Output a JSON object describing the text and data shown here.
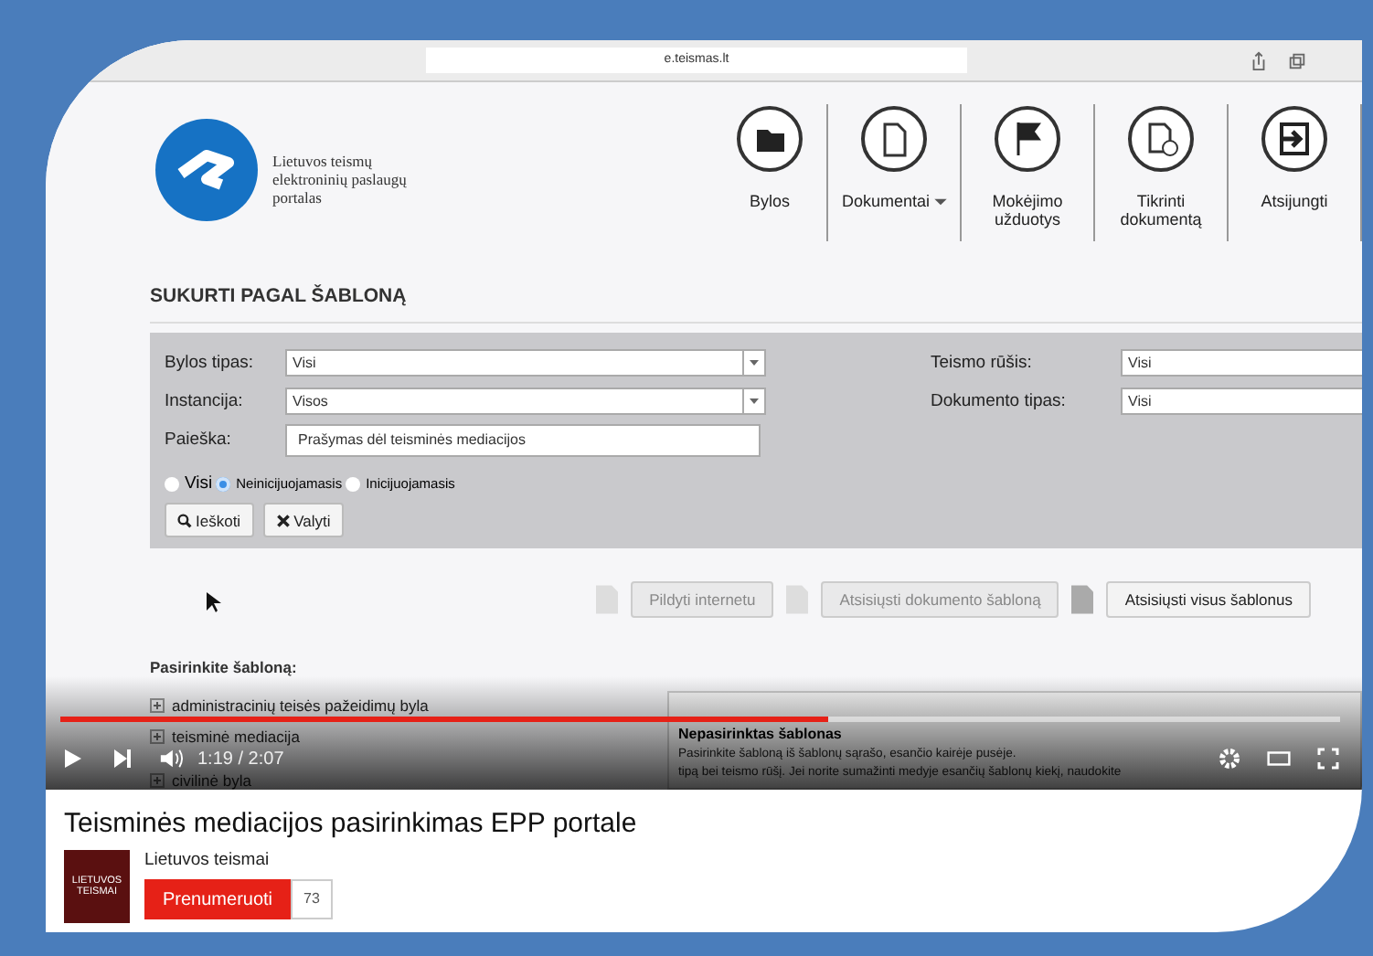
{
  "browser": {
    "url": "e.teismas.lt"
  },
  "site": {
    "logo_text": [
      "Lietuvos teismų",
      "elektroninių paslaugų",
      "portalas"
    ],
    "nav": [
      {
        "label": "Bylos",
        "kind": "folder",
        "caret": false
      },
      {
        "label": "Dokumentai",
        "kind": "document",
        "caret": true
      },
      {
        "label": "Mokėjimo užduotys",
        "kind": "flag",
        "caret": false
      },
      {
        "label": "Tikrinti dokumentą",
        "kind": "check",
        "caret": false
      },
      {
        "label": "Atsijungti",
        "kind": "logout",
        "caret": false
      }
    ]
  },
  "form": {
    "title": "SUKURTI PAGAL ŠABLONĄ",
    "left_fields": [
      {
        "label": "Bylos tipas:",
        "value": "Visi",
        "kind": "select"
      },
      {
        "label": "Instancija:",
        "value": "Visos",
        "kind": "select"
      },
      {
        "label": "Paieška:",
        "value": "Prašymas dėl teisminės mediacijos",
        "kind": "text"
      }
    ],
    "right_fields": [
      {
        "label": "Teismo rūšis:",
        "value": "Visi"
      },
      {
        "label": "Dokumento tipas:",
        "value": "Visi"
      }
    ],
    "radios": [
      {
        "label": "Visi",
        "selected": false
      },
      {
        "label": "Neinicijuojamasis",
        "selected": true
      },
      {
        "label": "Inicijuojamasis",
        "selected": false
      }
    ],
    "buttons": [
      {
        "label": "Ieškoti",
        "kind": "search"
      },
      {
        "label": "Valyti",
        "kind": "clear"
      }
    ]
  },
  "actions": [
    {
      "label": "Pildyti internetu",
      "disabled": true
    },
    {
      "label": "Atsisiųsti dokumento šabloną",
      "disabled": true
    },
    {
      "label": "Atsisiųsti visus šablonus",
      "disabled": false
    }
  ],
  "templates": {
    "heading": "Pasirinkite šabloną:",
    "tree": [
      {
        "label": "administracinių teisės pažeidimų byla"
      },
      {
        "label": "teisminė mediacija"
      },
      {
        "label": "civilinė byla"
      }
    ],
    "panel_title": "Nepasirinktas šablonas",
    "panel_text": [
      "Pasirinkite šabloną iš šablonų sąrašo, esančio kairėje pusėje.",
      "tipą bei teismo rūšį. Jei norite sumažinti medyje esančių šablonų kiekį, naudokite"
    ]
  },
  "player": {
    "level": 0.6,
    "time": "1:19 / 2:07"
  },
  "video": {
    "title": "Teisminės mediacijos pasirinkimas EPP portale",
    "channel": "Lietuvos teismai",
    "avatar_text": "LIETUVOS TEISMAI",
    "subscribe": "Prenumeruoti",
    "subscribers": "73"
  }
}
